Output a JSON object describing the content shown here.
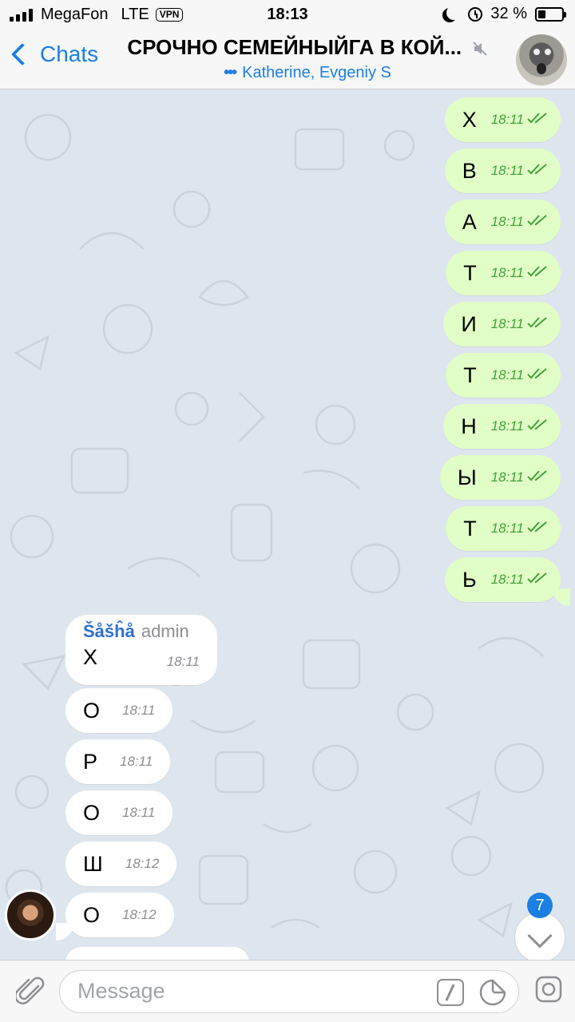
{
  "status_bar": {
    "carrier": "MegaFon",
    "network": "LTE",
    "vpn": "VPN",
    "time": "18:13",
    "battery": "32 %",
    "battery_level": 0.32
  },
  "header": {
    "back_label": "Chats",
    "title": "СРОЧНО СЕМЕЙНЫЙГА В КОЙ...",
    "subtitle_dots": "•••",
    "subtitle": "Katherine, Evgeniy S"
  },
  "outgoing": [
    {
      "text": "Х",
      "time": "18:11"
    },
    {
      "text": "В",
      "time": "18:11"
    },
    {
      "text": "А",
      "time": "18:11"
    },
    {
      "text": "Т",
      "time": "18:11"
    },
    {
      "text": "И",
      "time": "18:11"
    },
    {
      "text": "Т",
      "time": "18:11"
    },
    {
      "text": "Н",
      "time": "18:11"
    },
    {
      "text": "Ы",
      "time": "18:11"
    },
    {
      "text": "Т",
      "time": "18:11"
    },
    {
      "text": "Ь",
      "time": "18:11"
    }
  ],
  "incoming": {
    "sender": "Šåšĥå",
    "role": "admin",
    "messages": [
      {
        "text": "Х",
        "time": "18:11"
      },
      {
        "text": "О",
        "time": "18:11"
      },
      {
        "text": "Р",
        "time": "18:11"
      },
      {
        "text": "О",
        "time": "18:11"
      },
      {
        "text": "Ш",
        "time": "18:12"
      },
      {
        "text": "О",
        "time": "18:12"
      }
    ]
  },
  "unread_badge": "7",
  "input": {
    "placeholder": "Message"
  },
  "colors": {
    "accent": "#1b7fe3",
    "outgoing_bubble": "#e1fec6",
    "outgoing_meta": "#3fa33a",
    "chat_background": "#dde6ef"
  }
}
